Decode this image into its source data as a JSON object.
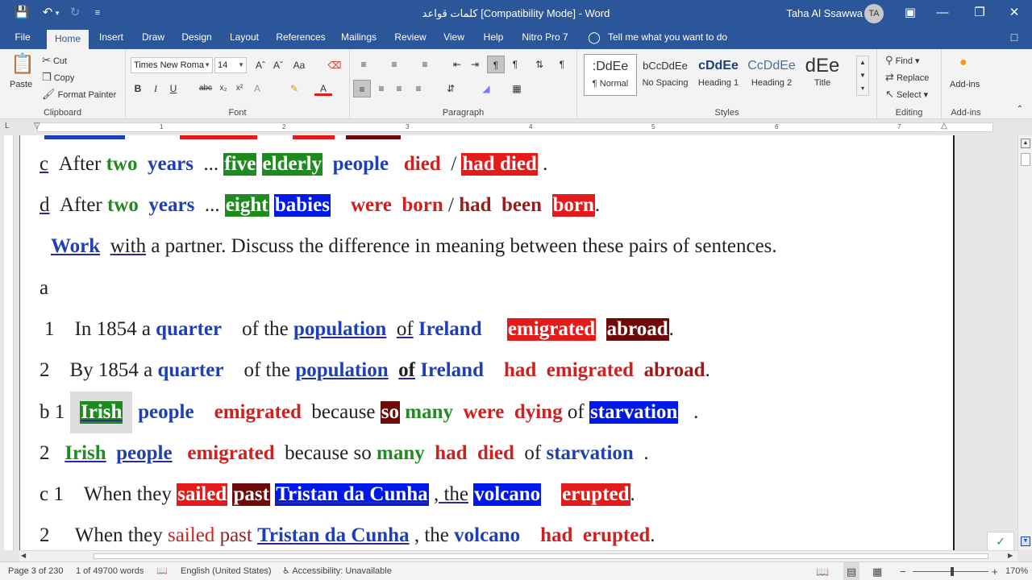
{
  "title_bar": {
    "doc_title": "كلمات قواعد [Compatibility Mode]  -  Word",
    "user_name": "Taha Al Ssawwa",
    "user_initials": "TA"
  },
  "tabs": [
    "File",
    "Home",
    "Insert",
    "Draw",
    "Design",
    "Layout",
    "References",
    "Mailings",
    "Review",
    "View",
    "Help",
    "Nitro Pro 7"
  ],
  "active_tab": "Home",
  "tell_me": "Tell me what you want to do",
  "ribbon": {
    "clipboard": {
      "paste": "Paste",
      "cut": "Cut",
      "copy": "Copy",
      "format_painter": "Format Painter",
      "label": "Clipboard"
    },
    "font": {
      "name": "Times New Roma",
      "size": "14",
      "label": "Font"
    },
    "paragraph": {
      "label": "Paragraph"
    },
    "styles": {
      "label": "Styles",
      "items": [
        {
          "preview": ":DdEe",
          "name": "¶ Normal"
        },
        {
          "preview": "bCcDdEe",
          "name": "No Spacing"
        },
        {
          "preview": "cDdEe",
          "name": "Heading 1"
        },
        {
          "preview": "CcDdEe",
          "name": "Heading 2"
        },
        {
          "preview": "dEe",
          "name": "Title"
        }
      ]
    },
    "editing": {
      "find": "Find",
      "replace": "Replace",
      "select": "Select",
      "label": "Editing"
    },
    "addins": {
      "addins": "Add-ins",
      "label": "Add-ins"
    }
  },
  "ruler_numbers": [
    "1",
    "2",
    "3",
    "4",
    "5",
    "6",
    "7"
  ],
  "document": {
    "line_c": {
      "prefix": "c",
      "t1": "After",
      "t2": "two",
      "t3": "years",
      "t4": "...",
      "t5": "five",
      "t6": "elderly",
      "t7": "people",
      "t8": "died",
      "t9": "/",
      "t10": "had  died",
      "t11": "."
    },
    "line_d": {
      "prefix": "d",
      "t1": "After",
      "t2": "two",
      "t3": "years",
      "t4": "...",
      "t5": "eight",
      "t6": "babies",
      "t7": "were",
      "t8": "born",
      "t9": "/",
      "t10": "had",
      "t11": "been",
      "t12": "born",
      "t13": "."
    },
    "line_work": {
      "t1": "Work",
      "t2": "with",
      "t3": "a partner. Discuss the difference in meaning between these pairs of sentences."
    },
    "line_a": {
      "t1": "a"
    },
    "line_a1": {
      "num": "1",
      "t1": "In 1854 a",
      "t2": "quarter",
      "t3": "of the",
      "t4": "population",
      "t5": "of",
      "t6": "Ireland",
      "t7": "emigrated",
      "t8": "abroad",
      "t9": "."
    },
    "line_a2": {
      "num": "2",
      "t1": "By 1854 a",
      "t2": "quarter",
      "t3": "of the",
      "t4": "population",
      "t5": "of",
      "t6": "Ireland",
      "t7": "had",
      "t8": "emigrated",
      "t9": "abroad",
      "t10": "."
    },
    "line_b1": {
      "num": "b 1",
      "t1": "Irish",
      "t2": "people",
      "t3": "emigrated",
      "t4": "because",
      "t5": "so",
      "t6": "many",
      "t7": "were",
      "t8": "dying",
      "t9": "of",
      "t10": "starvation",
      "t11": "."
    },
    "line_b2": {
      "num": "2",
      "t1": "Irish",
      "t2": "people",
      "t3": "emigrated",
      "t4": "because so",
      "t5": "many",
      "t6": "had",
      "t7": "died",
      "t8": "of",
      "t9": "starvation",
      "t10": "."
    },
    "line_c1": {
      "num": "c 1",
      "t1": "When they",
      "t2": "sailed",
      "t3": "past",
      "t4": "Tristan da Cunha",
      "t5": ", the",
      "t6": "volcano",
      "t7": "erupted",
      "t8": "."
    },
    "line_c2": {
      "num": "2",
      "t1": "When they",
      "t2": "sailed",
      "t3": "past",
      "t4": "Tristan da Cunha",
      "t5": ", the",
      "t6": "volcano",
      "t7": "had",
      "t8": "erupted",
      "t9": "."
    }
  },
  "status_bar": {
    "page": "Page 3 of 230",
    "words": "1 of 49700 words",
    "language": "English (United States)",
    "accessibility": "Accessibility: Unavailable",
    "zoom": "170%"
  }
}
